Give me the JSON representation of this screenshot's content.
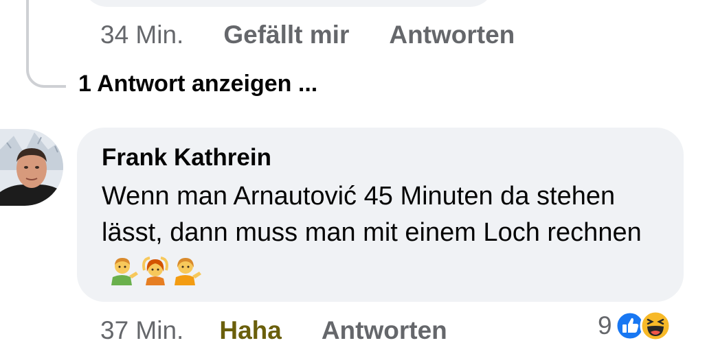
{
  "previous_comment": {
    "time": "34 Min.",
    "like_label": "Gefällt mir",
    "reply_label": "Antworten",
    "show_replies": "1 Antwort anzeigen ..."
  },
  "comment": {
    "author": "Frank Kathrein",
    "text": "Wenn man Arnautović 45 Minuten da stehen lässt, dann muss man mit einem Loch rechnen",
    "emojis": [
      "man-tipping-hand-icon",
      "person-gesturing-ok-icon",
      "person-tipping-hand-icon"
    ],
    "time": "37 Min.",
    "reaction_label": "Haha",
    "reply_label": "Antworten",
    "reaction_count": "9",
    "reaction_icons": [
      "like-icon",
      "haha-icon"
    ],
    "colors": {
      "haha_label": "#6a5f0b",
      "like_blue": "#1877f2",
      "bubble": "#f0f2f5",
      "meta": "#65676b"
    }
  }
}
